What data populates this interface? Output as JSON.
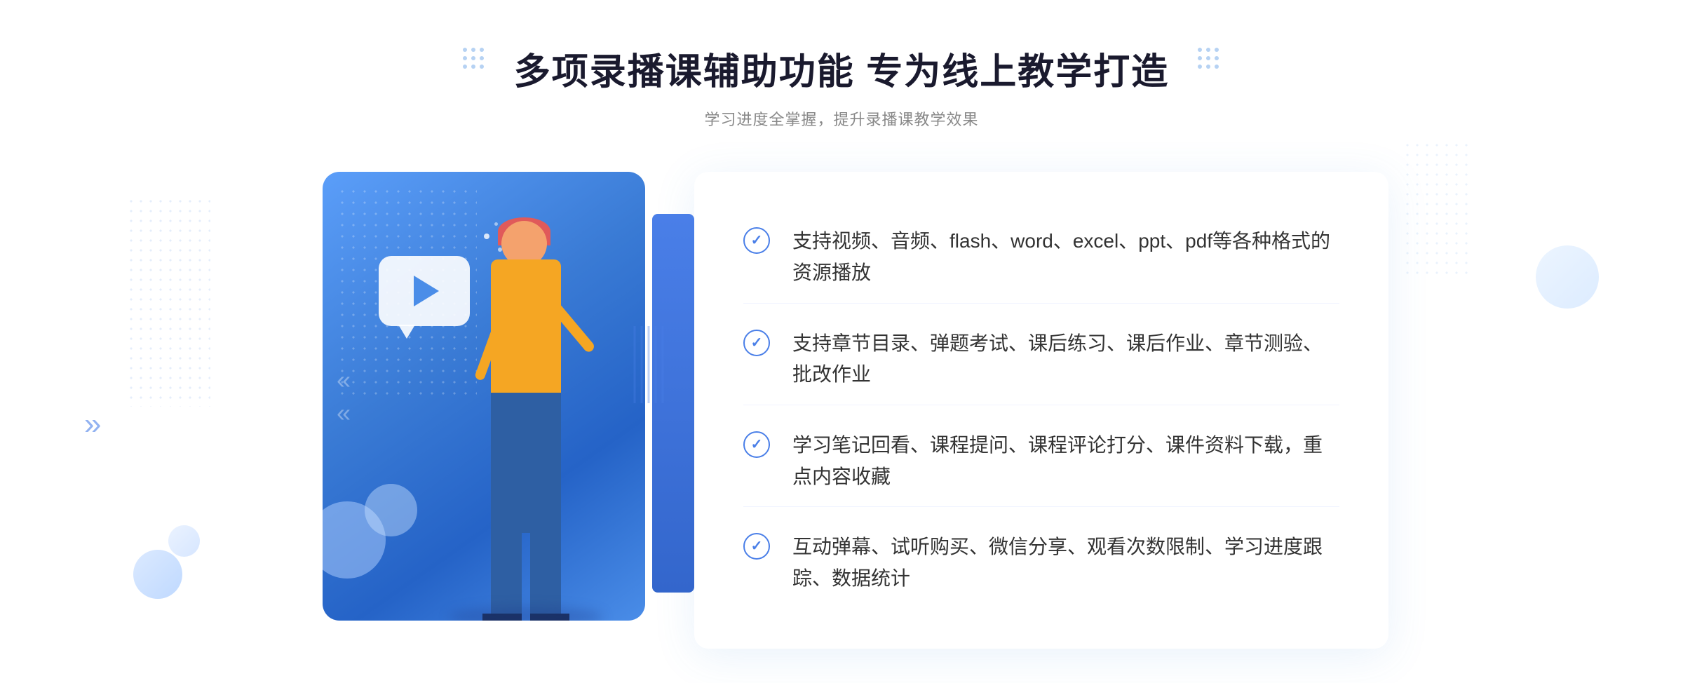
{
  "page": {
    "title": "多项录播课辅助功能 专为线上教学打造",
    "subtitle": "学习进度全掌握，提升录播课教学效果"
  },
  "features": [
    {
      "id": 1,
      "text": "支持视频、音频、flash、word、excel、ppt、pdf等各种格式的资源播放"
    },
    {
      "id": 2,
      "text": "支持章节目录、弹题考试、课后练习、课后作业、章节测验、批改作业"
    },
    {
      "id": 3,
      "text": "学习笔记回看、课程提问、课程评论打分、课件资料下载，重点内容收藏"
    },
    {
      "id": 4,
      "text": "互动弹幕、试听购买、微信分享、观看次数限制、学习进度跟踪、数据统计"
    }
  ],
  "icons": {
    "check": "✓",
    "play": "▶",
    "chevron": "»"
  },
  "colors": {
    "primary": "#4a7fe8",
    "title": "#1a1a2e",
    "subtitle": "#888888",
    "text": "#333333",
    "border": "#f0f4ff"
  }
}
